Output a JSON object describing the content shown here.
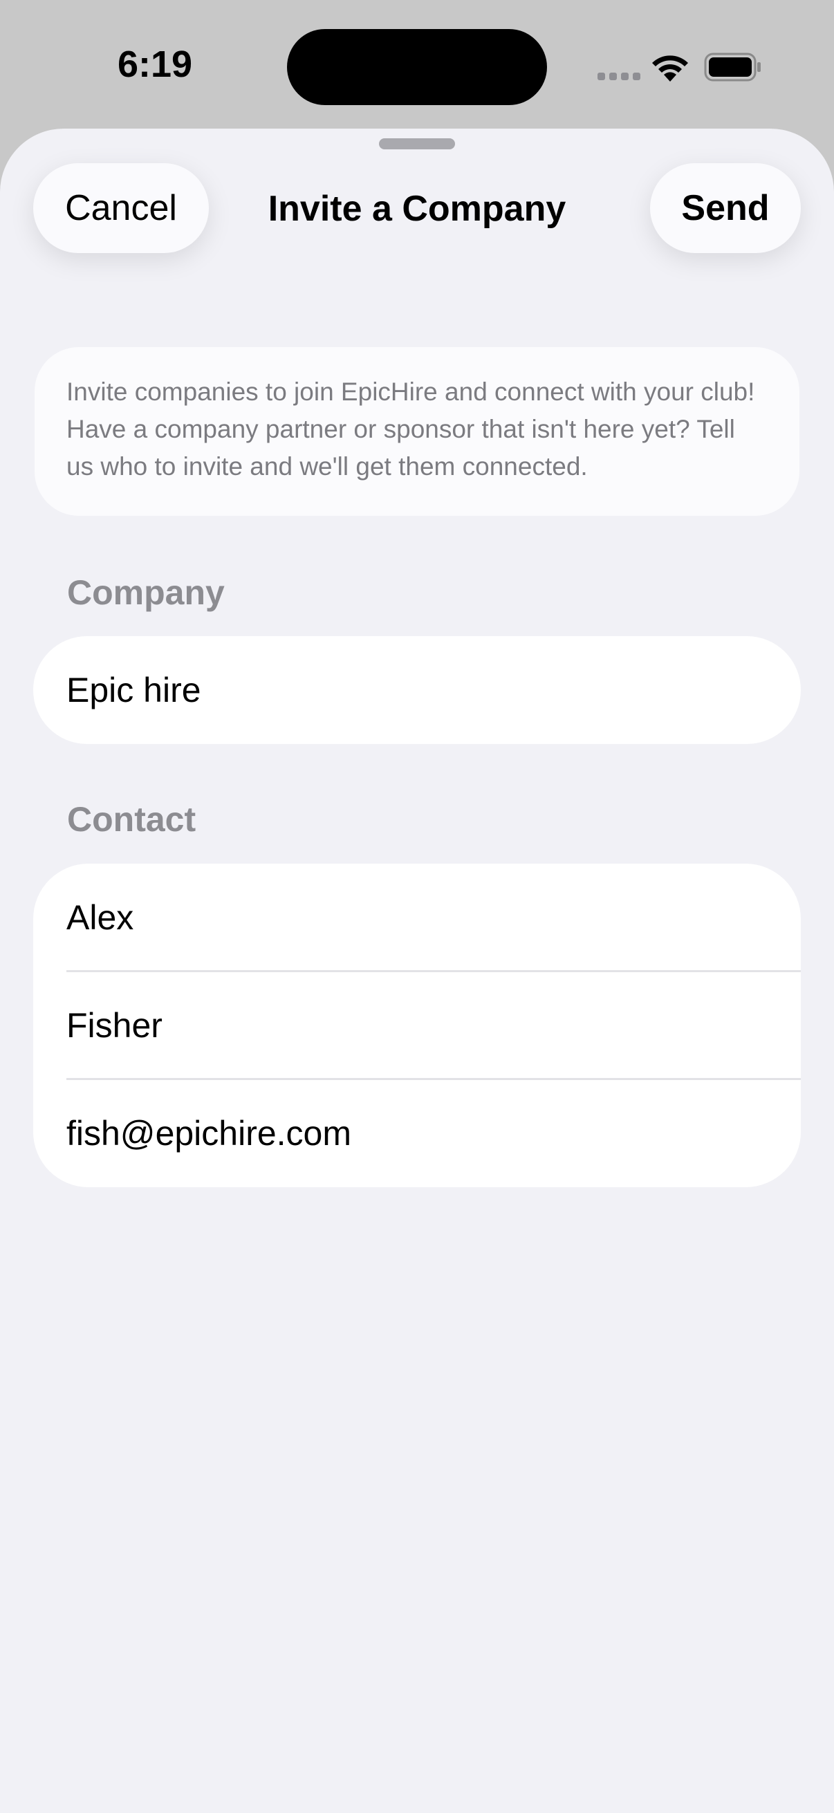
{
  "status_bar": {
    "time": "6:19"
  },
  "nav": {
    "cancel_label": "Cancel",
    "title": "Invite a Company",
    "send_label": "Send"
  },
  "info": {
    "text": "Invite companies to join EpicHire and connect with your club! Have a company partner or sponsor that isn't here yet? Tell us who to invite and we'll get them connected."
  },
  "company_section": {
    "header": "Company",
    "company_name": "Epic hire"
  },
  "contact_section": {
    "header": "Contact",
    "first_name": "Alex",
    "last_name": "Fisher",
    "email": "fish@epichire.com"
  },
  "colors": {
    "sheet_background": "#f1f1f6",
    "card_background": "#ffffff",
    "section_header": "#8c8c91",
    "info_text": "#7b7b80"
  },
  "icons": [
    "signal-icon",
    "wifi-icon",
    "battery-icon"
  ]
}
